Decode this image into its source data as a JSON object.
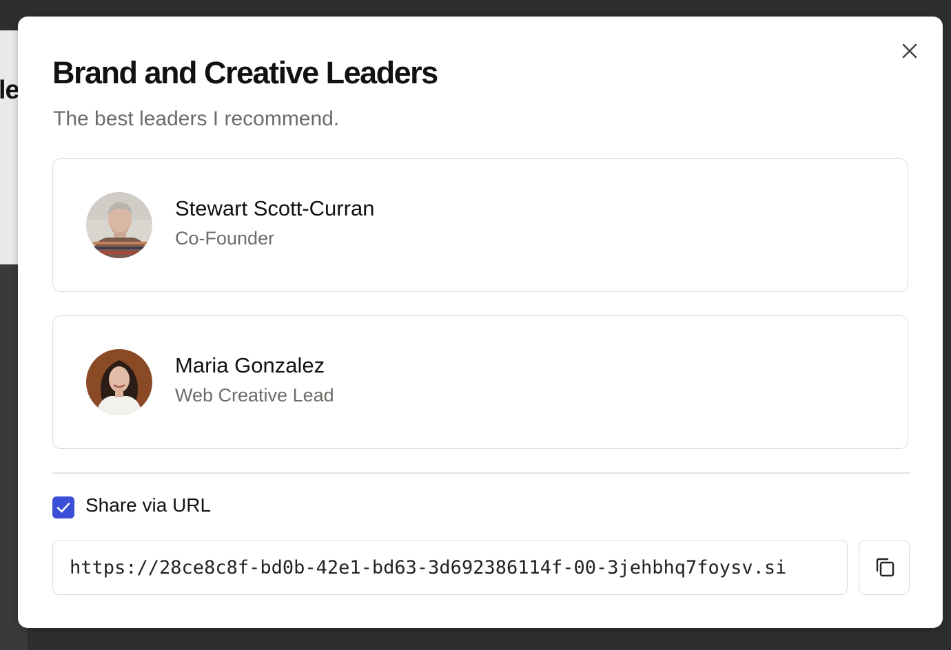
{
  "background": {
    "text_snippet": "le"
  },
  "modal": {
    "title": "Brand and Creative Leaders",
    "subtitle": "The best leaders I recommend.",
    "close_icon": "close-icon"
  },
  "people": [
    {
      "name": "Stewart Scott-Curran",
      "role": "Co-Founder",
      "avatar": "avatar-photo"
    },
    {
      "name": "Maria Gonzalez",
      "role": "Web Creative Lead",
      "avatar": "avatar-photo"
    }
  ],
  "share": {
    "checkbox_checked": true,
    "label": "Share via URL",
    "url": "https://28ce8c8f-bd0b-42e1-bd63-3d692386114f-00-3jehbhq7foysv.si",
    "copy_icon": "copy-icon"
  },
  "colors": {
    "accent": "#3a4fd6",
    "backdrop": "#2e2e2e",
    "muted_text": "#6d6b66",
    "border": "#dcdcdc"
  }
}
